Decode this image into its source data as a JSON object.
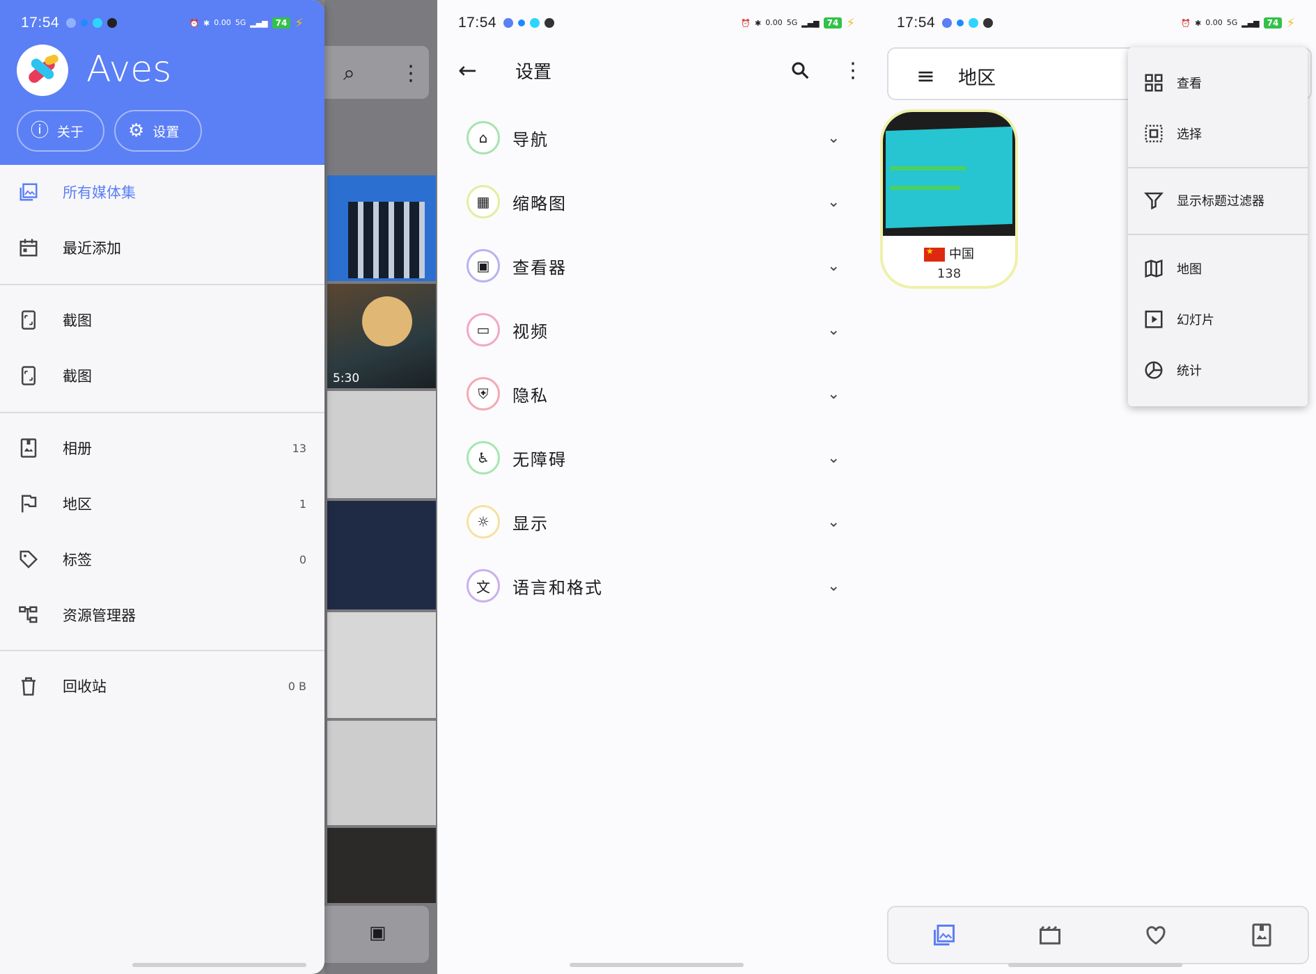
{
  "status_time": "17:54",
  "status_speed": "0.00",
  "status_speed_unit": "KB/s",
  "status_network": "5G",
  "status_battery": "74",
  "drawer": {
    "app_title": "Aves",
    "chip_about": "关于",
    "chip_settings": "设置",
    "items": [
      {
        "label": "所有媒体集",
        "count": "",
        "icon": "collection-icon"
      },
      {
        "label": "最近添加",
        "count": "",
        "icon": "calendar-icon"
      },
      {
        "label": "截图",
        "count": "",
        "icon": "phone-screenshot-icon"
      },
      {
        "label": "截图",
        "count": "",
        "icon": "phone-screenshot-icon"
      },
      {
        "label": "相册",
        "count": "13",
        "icon": "album-icon"
      },
      {
        "label": "地区",
        "count": "1",
        "icon": "flag-icon"
      },
      {
        "label": "标签",
        "count": "0",
        "icon": "tag-icon"
      },
      {
        "label": "资源管理器",
        "count": "",
        "icon": "explorer-icon"
      },
      {
        "label": "回收站",
        "count": "0 B",
        "icon": "trash-icon"
      }
    ],
    "video_duration": "5:30"
  },
  "settings": {
    "title": "设置",
    "sections": [
      {
        "label": "导航",
        "icon": "home-icon",
        "color": "#a9e3b0"
      },
      {
        "label": "缩略图",
        "icon": "grid-icon",
        "color": "#dff0a0"
      },
      {
        "label": "查看器",
        "icon": "image-icon",
        "color": "#b7b3f2"
      },
      {
        "label": "视频",
        "icon": "clapper-icon",
        "color": "#f2a8c8"
      },
      {
        "label": "隐私",
        "icon": "shield-icon",
        "color": "#f5a9b5"
      },
      {
        "label": "无障碍",
        "icon": "accessibility-icon",
        "color": "#a5e8b0"
      },
      {
        "label": "显示",
        "icon": "sun-icon",
        "color": "#f7e1a0"
      },
      {
        "label": "语言和格式",
        "icon": "translate-icon",
        "color": "#cbb0f0"
      }
    ]
  },
  "regions": {
    "title": "地区",
    "card": {
      "name": "中国",
      "count": "138"
    },
    "menu": [
      {
        "label": "查看",
        "icon": "grid-view-icon"
      },
      {
        "label": "选择",
        "icon": "select-icon"
      },
      {
        "label": "显示标题过滤器",
        "icon": "filter-icon"
      },
      {
        "label": "地图",
        "icon": "map-icon"
      },
      {
        "label": "幻灯片",
        "icon": "slideshow-icon"
      },
      {
        "label": "统计",
        "icon": "stats-icon"
      }
    ],
    "bottom_nav": [
      "collection-icon",
      "clapper-icon",
      "heart-icon",
      "album-icon"
    ]
  },
  "colors": {
    "accent": "#5b7ff5",
    "drawer_header": "#5b7ff5"
  }
}
